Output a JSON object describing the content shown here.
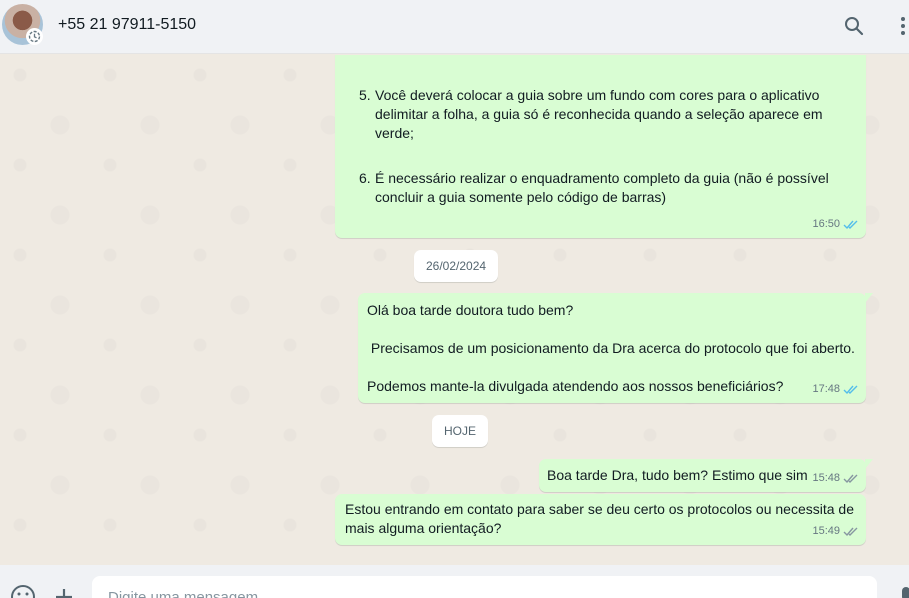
{
  "header": {
    "contact_name": "+55 21 97911-5150",
    "icons": [
      "search-icon",
      "menu-dots-icon"
    ]
  },
  "messages": {
    "m1": {
      "items": [
        {
          "num": "5.",
          "text": "Você deverá colocar a guia sobre um fundo com cores para o aplicativo delimitar a folha, a guia só é reconhecida quando a seleção aparece em verde;"
        },
        {
          "num": "6.",
          "text": "É necessário realizar o enquadramento completo da guia (não é possível concluir a guia somente pelo código de barras)"
        }
      ],
      "time": "16:50",
      "status": "read"
    },
    "date1": "26/02/2024",
    "m2": {
      "line1": "Olá boa tarde doutora tudo bem?",
      "line2": " Precisamos de um posicionamento da Dra acerca do protocolo que foi aberto.",
      "line3": "Podemos mante-la divulgada atendendo aos nossos beneficiários?",
      "time": "17:48",
      "status": "read"
    },
    "date2": "HOJE",
    "m3": {
      "text": "Boa tarde Dra, tudo bem? Estimo que sim",
      "time": "15:48",
      "status": "delivered"
    },
    "m4": {
      "text": "Estou entrando em contato para saber se deu certo os protocolos ou necessita de mais alguma orientação?",
      "time": "15:49",
      "status": "delivered"
    }
  },
  "composer": {
    "placeholder": "Digite uma mensagem",
    "icons": [
      "emoji-icon",
      "attach-icon",
      "mic-icon"
    ]
  },
  "colors": {
    "outgoing_bubble": "#d9fdd3",
    "read_ticks": "#53bdeb",
    "delivered_ticks": "#8696a0",
    "chat_background": "#efeae2",
    "header_background": "#f0f2f5"
  }
}
